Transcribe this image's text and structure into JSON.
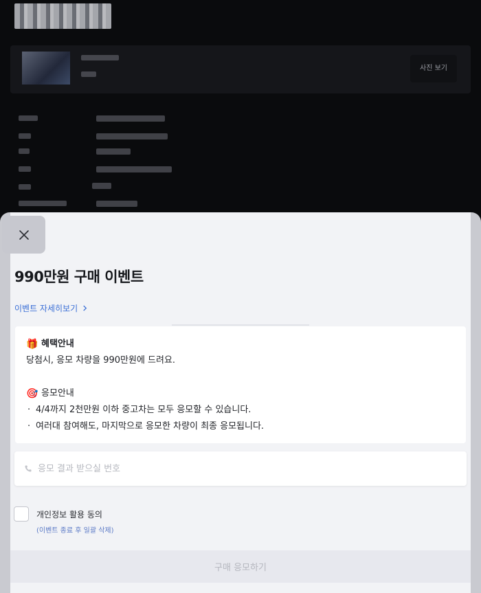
{
  "background": {
    "photo_button_label": "사진 보기"
  },
  "sheet": {
    "title": "990만원 구매 이벤트",
    "detail_link": "이벤트 자세히보기",
    "benefit": {
      "icon": "gift-icon",
      "heading": "혜택안내",
      "body": "당첨시, 응모 차량을 990만원에 드려요."
    },
    "entry": {
      "icon": "target-icon",
      "heading": "응모안내",
      "bullets": [
        "4/4까지 2천만원 이하 중고차는 모두 응모할 수 있습니다.",
        "여러대 참여해도, 마지막으로 응모한 차량이 최종 응모됩니다."
      ]
    },
    "phone_input": {
      "placeholder": "응모 결과 받으실 번호",
      "value": ""
    },
    "consent": {
      "label": "개인정보 활용 동의",
      "sublabel": "(이벤트 종료 후 일괄 삭제)",
      "checked": false
    },
    "submit_label": "구매 응모하기"
  },
  "colors": {
    "link": "#3b6fd6",
    "sheet_bg": "#f2f3f6",
    "button_disabled_bg": "#e7e8ee",
    "button_disabled_text": "#b4b6be"
  }
}
